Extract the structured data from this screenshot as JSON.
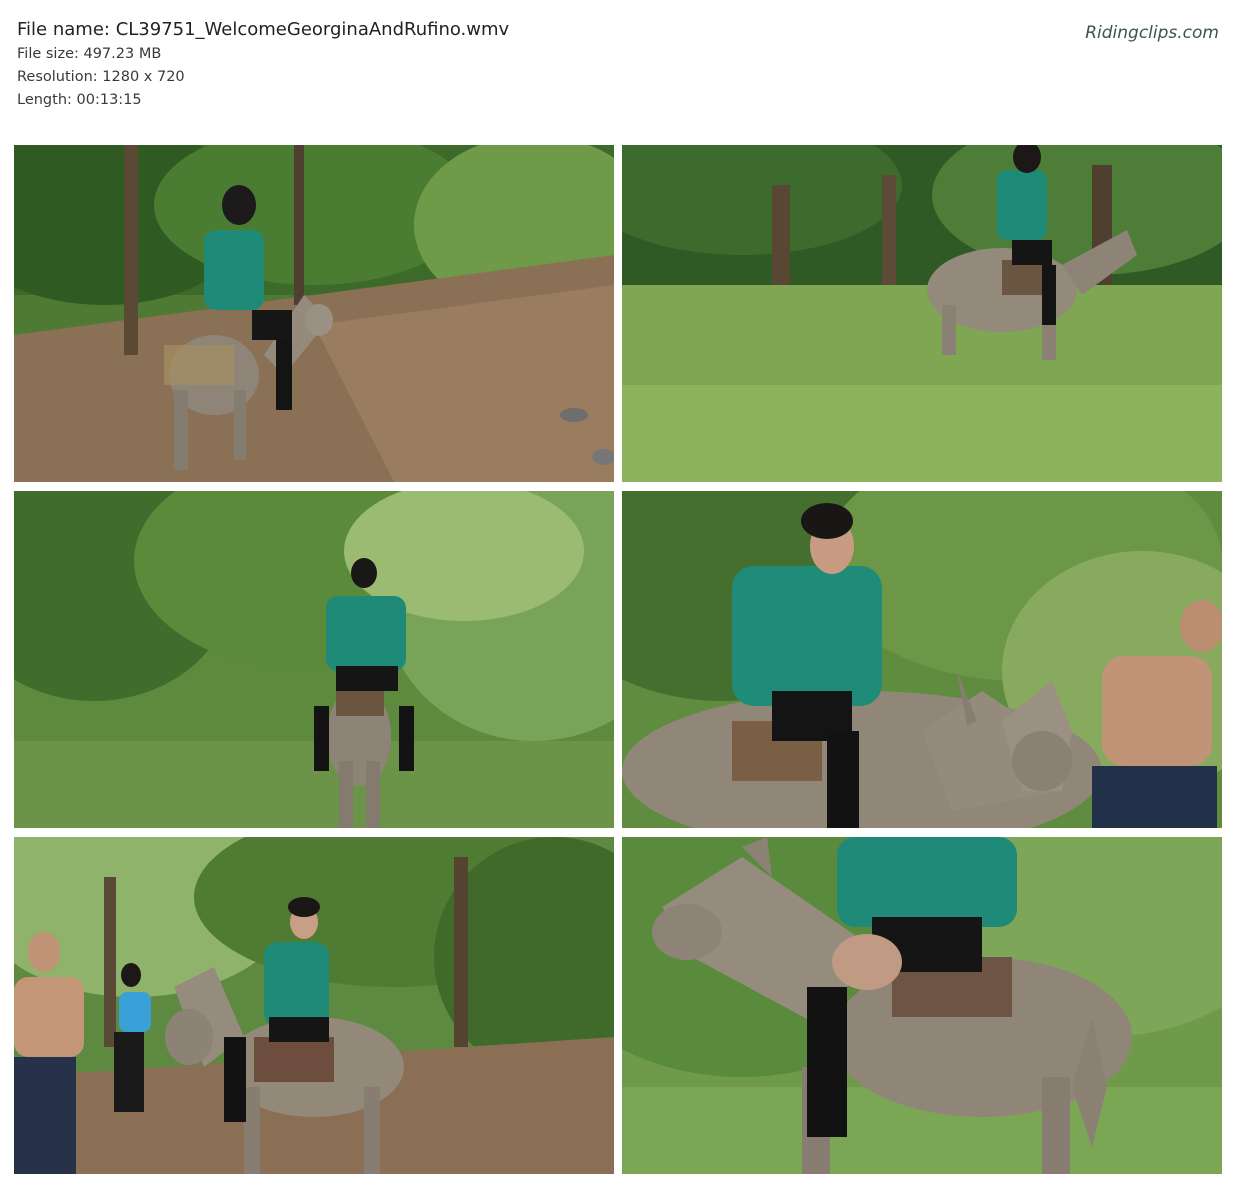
{
  "header": {
    "file_name_label": "File name:",
    "file_name": "CL39751_WelcomeGeorginaAndRufino.wmv",
    "file_size_label": "File size:",
    "file_size": "497.23 MB",
    "resolution_label": "Resolution:",
    "resolution": "1280 x 720",
    "length_label": "Length:",
    "length": "00:13:15"
  },
  "brand": {
    "text": "Ridingclips.com"
  },
  "colors": {
    "foliage_dark": "#2f5a22",
    "foliage_light": "#7fa653",
    "ground": "#8a7055",
    "shirt": "#1f8a78",
    "donkey": "#8e8578"
  }
}
